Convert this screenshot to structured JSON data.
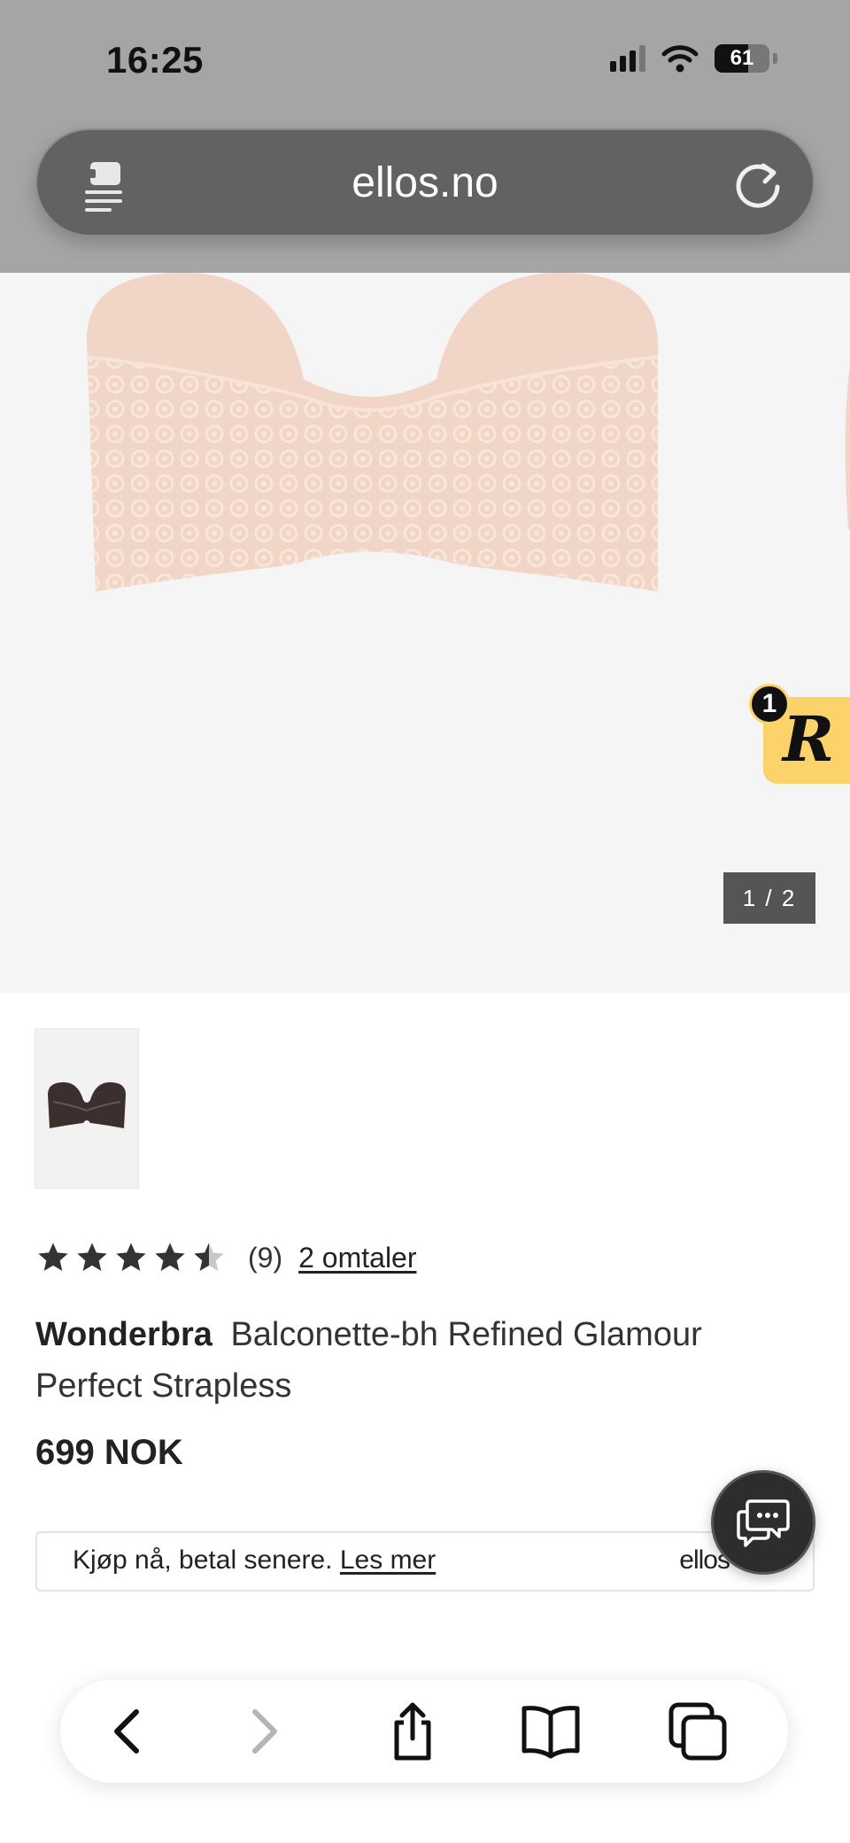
{
  "status_bar": {
    "time": "16:25",
    "battery": "61"
  },
  "browser": {
    "domain": "ellos.no"
  },
  "gallery": {
    "counter": "1 / 2"
  },
  "widget": {
    "badge_count": "1",
    "letter": "R"
  },
  "product": {
    "rating_value": 4.5,
    "rating_count": "(9)",
    "reviews_link": "2 omtaler",
    "brand": "Wonderbra",
    "name": "Balconette-bh Refined Glamour Perfect Strapless",
    "price": "699 NOK"
  },
  "pay_later": {
    "text": "Kjøp nå, betal senere.",
    "link": "Les mer",
    "logo": "ellos"
  },
  "toolbar": {
    "back_icon": "chevron-left-icon",
    "forward_icon": "chevron-right-icon",
    "share_icon": "share-icon",
    "bookmarks_icon": "book-icon",
    "tabs_icon": "tabs-icon"
  },
  "colors": {
    "widget_yellow": "#fcd36a",
    "product_nude": "#f1d6c8",
    "chat_dark": "#2d2d2d"
  }
}
